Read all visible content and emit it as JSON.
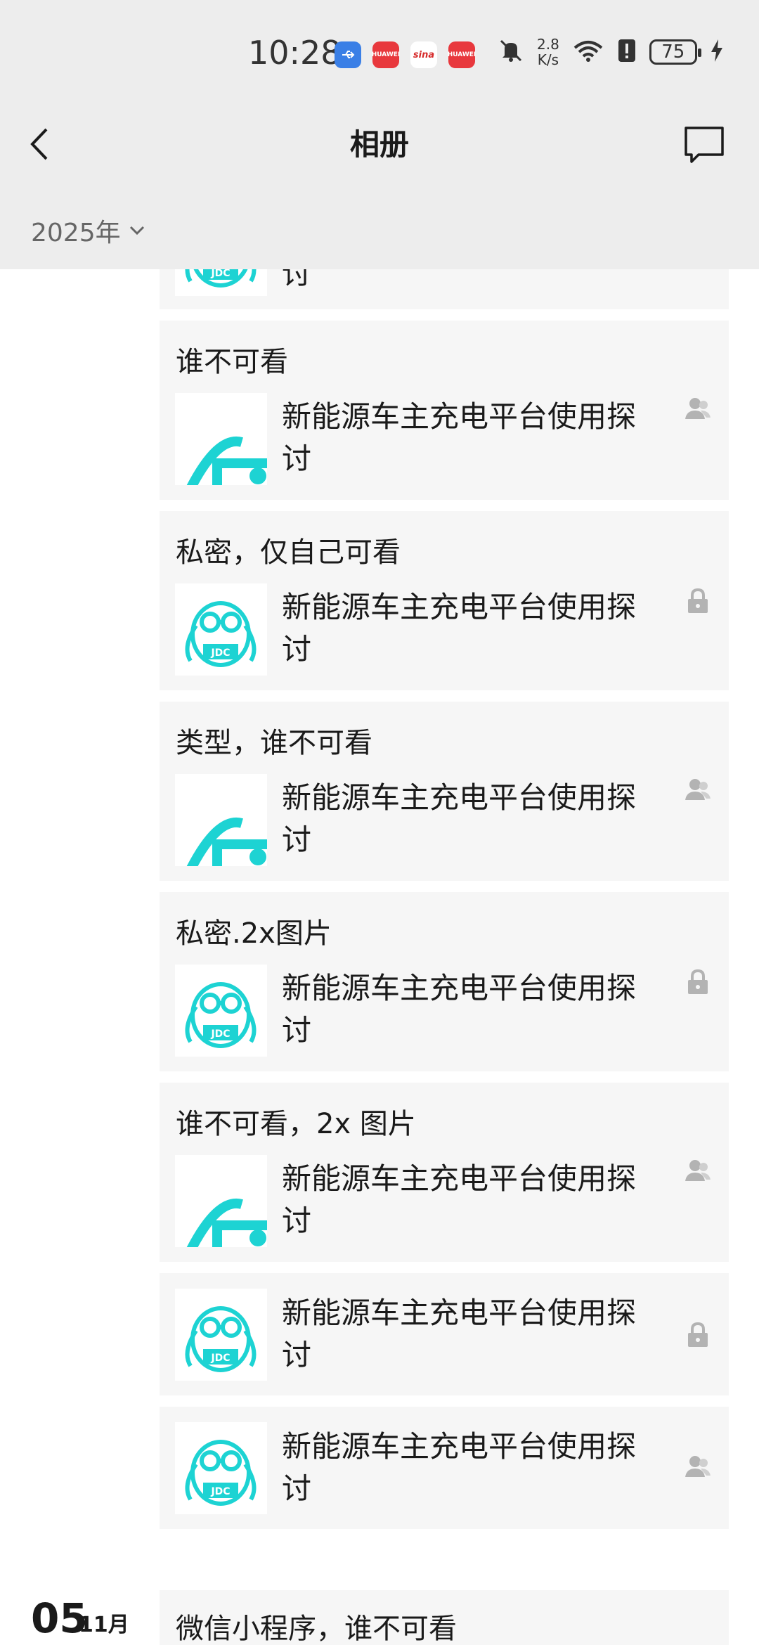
{
  "status_bar": {
    "time": "10:28",
    "notifications": [
      {
        "icon": "usb-icon",
        "label": ""
      },
      {
        "icon": "huawei-app-icon",
        "label": "HUAWEI"
      },
      {
        "icon": "sina-app-icon",
        "label": "sina"
      },
      {
        "icon": "huawei-app-icon",
        "label": "HUAWEI"
      }
    ],
    "network_speed_value": "2.8",
    "network_speed_unit": "K/s",
    "battery_level": "75"
  },
  "nav": {
    "title": "相册",
    "back_icon": "chevron-left-icon",
    "comment_icon": "comment-icon"
  },
  "filter": {
    "year_label": "2025年"
  },
  "posts": [
    {
      "caption": "",
      "title": "新能源车主充电平台使用探讨",
      "thumb": "jdc-logo",
      "permission": "people-icon"
    },
    {
      "caption": "谁不可看",
      "title": "新能源车主充电平台使用探讨",
      "thumb": "partial-logo",
      "permission": "people-icon"
    },
    {
      "caption": "私密，仅自己可看",
      "title": "新能源车主充电平台使用探讨",
      "thumb": "jdc-logo",
      "permission": "lock-icon"
    },
    {
      "caption": "类型，谁不可看",
      "title": "新能源车主充电平台使用探讨",
      "thumb": "partial-logo",
      "permission": "people-icon"
    },
    {
      "caption": "私密.2x图片",
      "title": "新能源车主充电平台使用探讨",
      "thumb": "jdc-logo",
      "permission": "lock-icon"
    },
    {
      "caption": "谁不可看，2x 图片",
      "title": "新能源车主充电平台使用探讨",
      "thumb": "partial-logo",
      "permission": "people-icon"
    },
    {
      "caption": "",
      "title": "新能源车主充电平台使用探讨",
      "thumb": "jdc-logo",
      "permission": "lock-icon"
    },
    {
      "caption": "",
      "title": "新能源车主充电平台使用探讨",
      "thumb": "jdc-logo",
      "permission": "people-icon"
    }
  ],
  "next_group": {
    "day": "05",
    "month": "11月",
    "caption": "微信小程序，谁不可看"
  },
  "colors": {
    "header_bg": "#ededed",
    "card_bg": "#f6f6f6",
    "logo_teal": "#1dd3d3",
    "permission_gray": "#b3b3b3"
  }
}
